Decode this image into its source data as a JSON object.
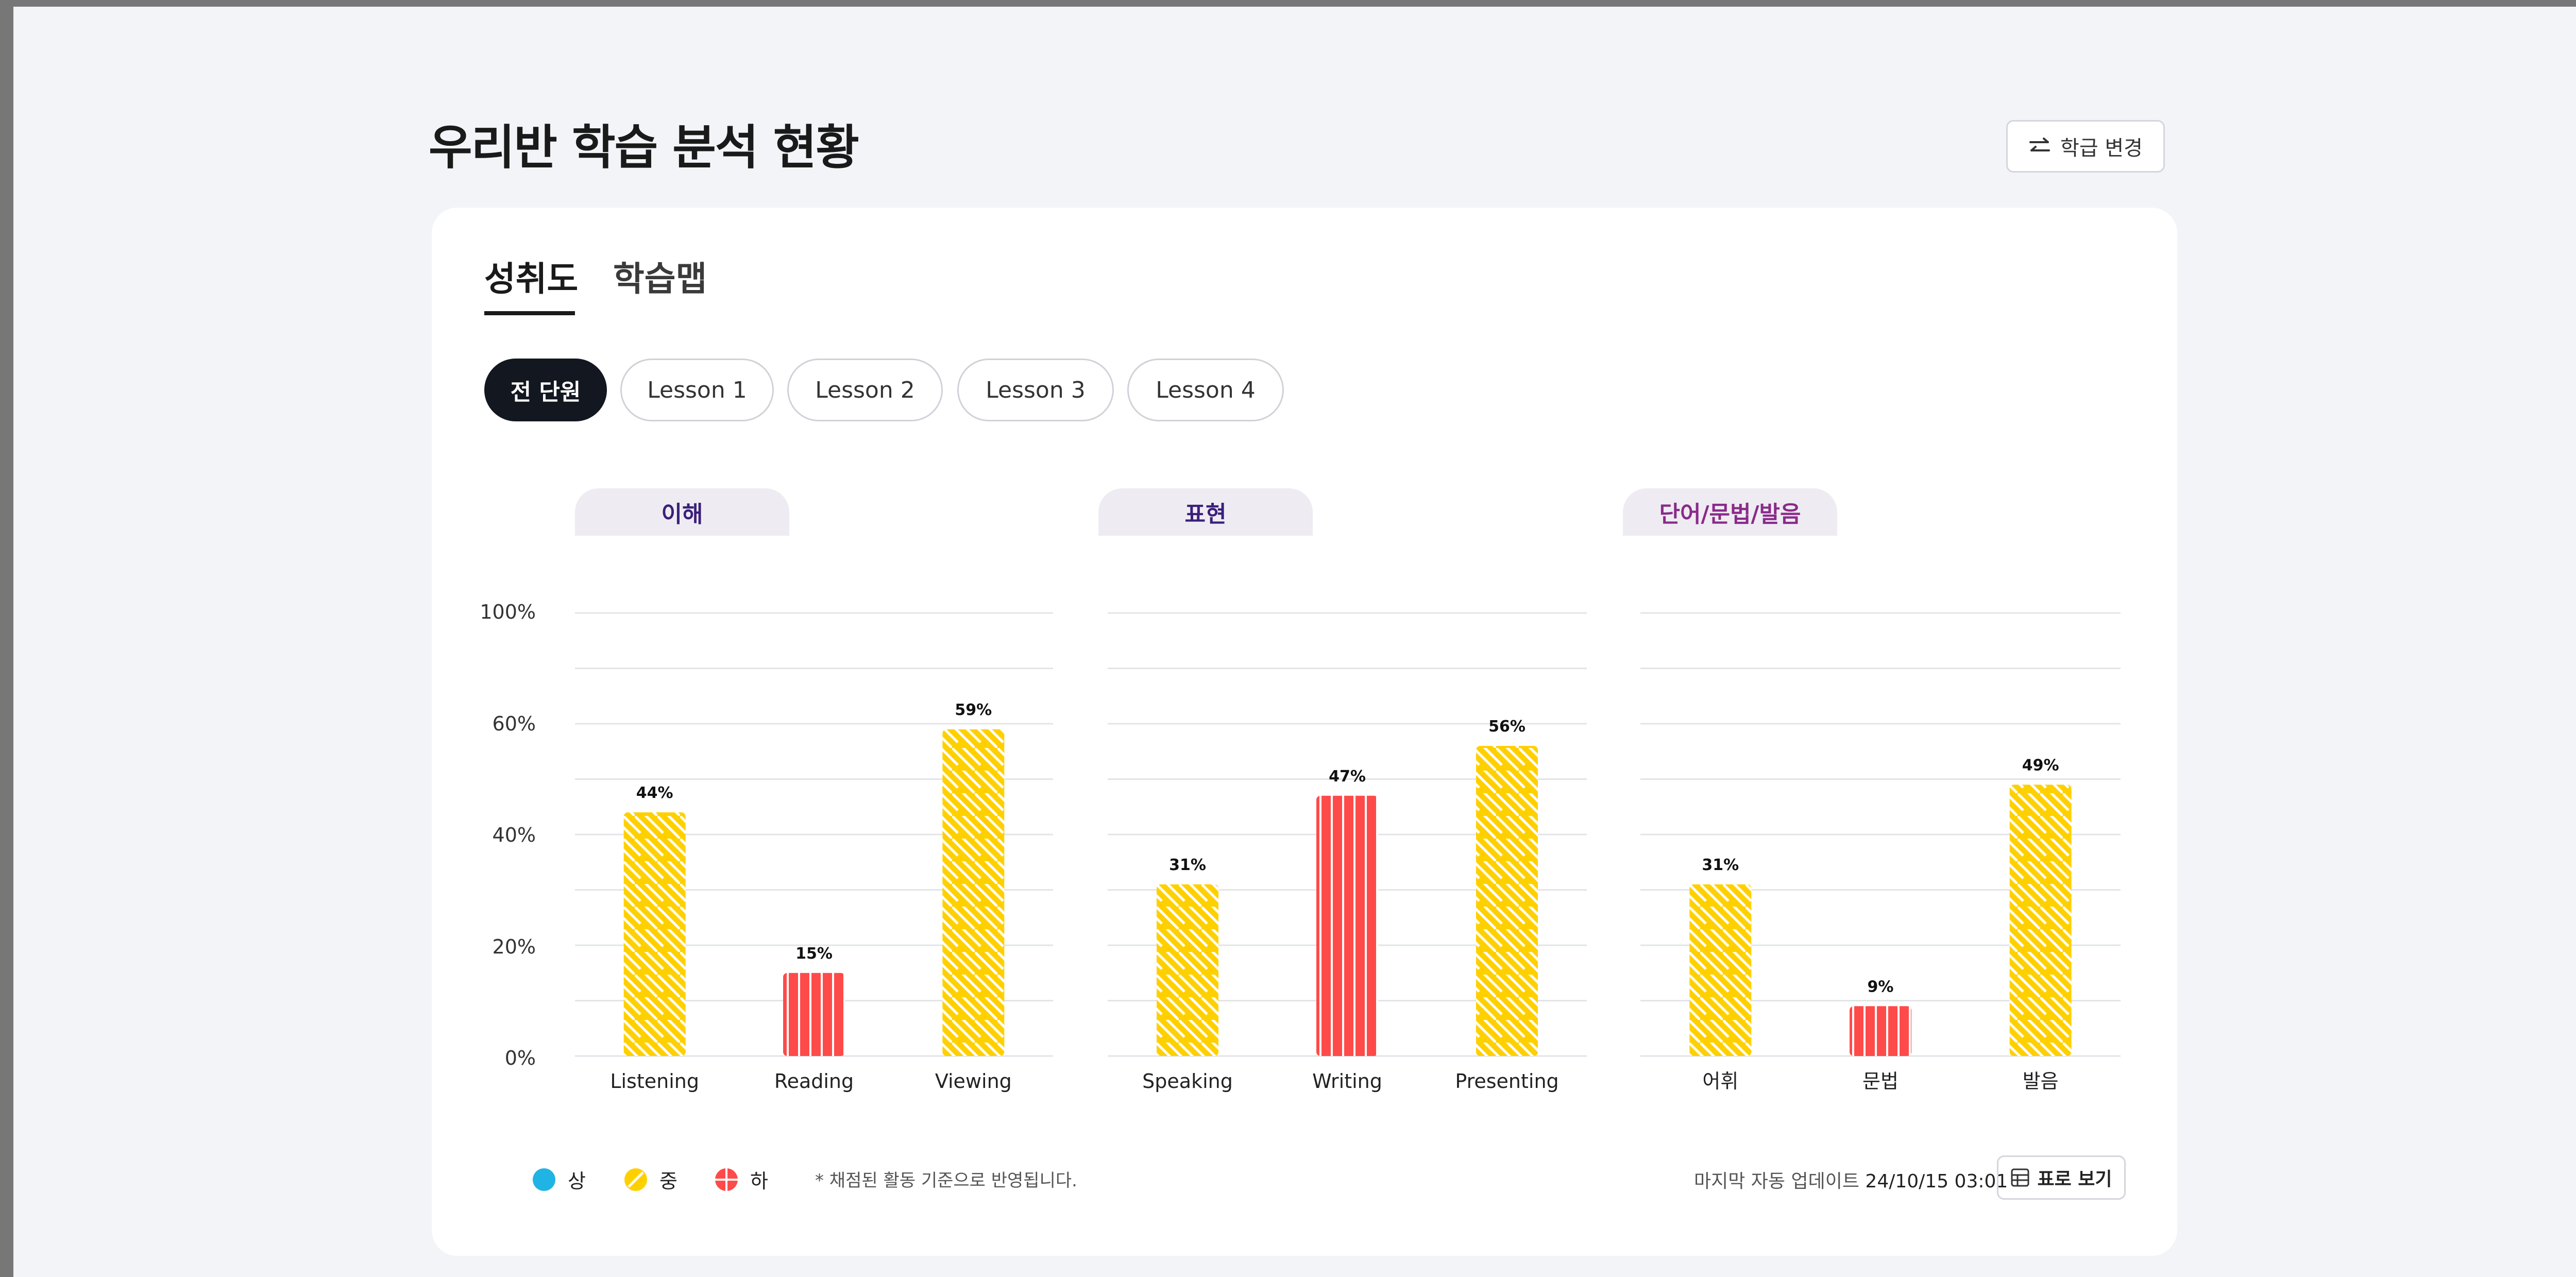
{
  "page_title": "우리반 학습 분석 현황",
  "class_change_label": "학급 변경",
  "tabs": [
    "성취도",
    "학습맵"
  ],
  "lesson_filters": [
    "전 단원",
    "Lesson 1",
    "Lesson 2",
    "Lesson 3",
    "Lesson 4"
  ],
  "categories": [
    "이해",
    "표현",
    "단어/문법/발음"
  ],
  "legend": {
    "high": "상",
    "mid": "중",
    "low": "하",
    "note": "* 채점된 활동 기준으로 반영됩니다."
  },
  "footer": {
    "update_prefix": "마지막 자동 업데이트",
    "update_time": "24/10/15 03:01",
    "table_view_label": "표로 보기"
  },
  "colors": {
    "high": "#1fb4e4",
    "mid": "#ffd000",
    "low": "#ff4a4a",
    "category_bg": "#eeecf2",
    "category_text": [
      "#3b1f7a",
      "#3b1f7a",
      "#8a2a8a"
    ]
  },
  "chart_data": {
    "type": "bar",
    "ylim": [
      0,
      80
    ],
    "y_ticks": [
      "0%",
      "20%",
      "40%",
      "60%",
      "100%"
    ],
    "groups": [
      {
        "name": "이해",
        "categories": [
          "Listening",
          "Reading",
          "Viewing"
        ],
        "values": [
          44,
          15,
          59
        ],
        "levels": [
          "mid",
          "low",
          "mid"
        ]
      },
      {
        "name": "표현",
        "categories": [
          "Speaking",
          "Writing",
          "Presenting"
        ],
        "values": [
          31,
          47,
          56
        ],
        "levels": [
          "mid",
          "low",
          "mid"
        ]
      },
      {
        "name": "단어/문법/발음",
        "categories": [
          "어휘",
          "문법",
          "발음"
        ],
        "values": [
          31,
          9,
          49
        ],
        "levels": [
          "mid",
          "low",
          "mid"
        ]
      }
    ]
  }
}
